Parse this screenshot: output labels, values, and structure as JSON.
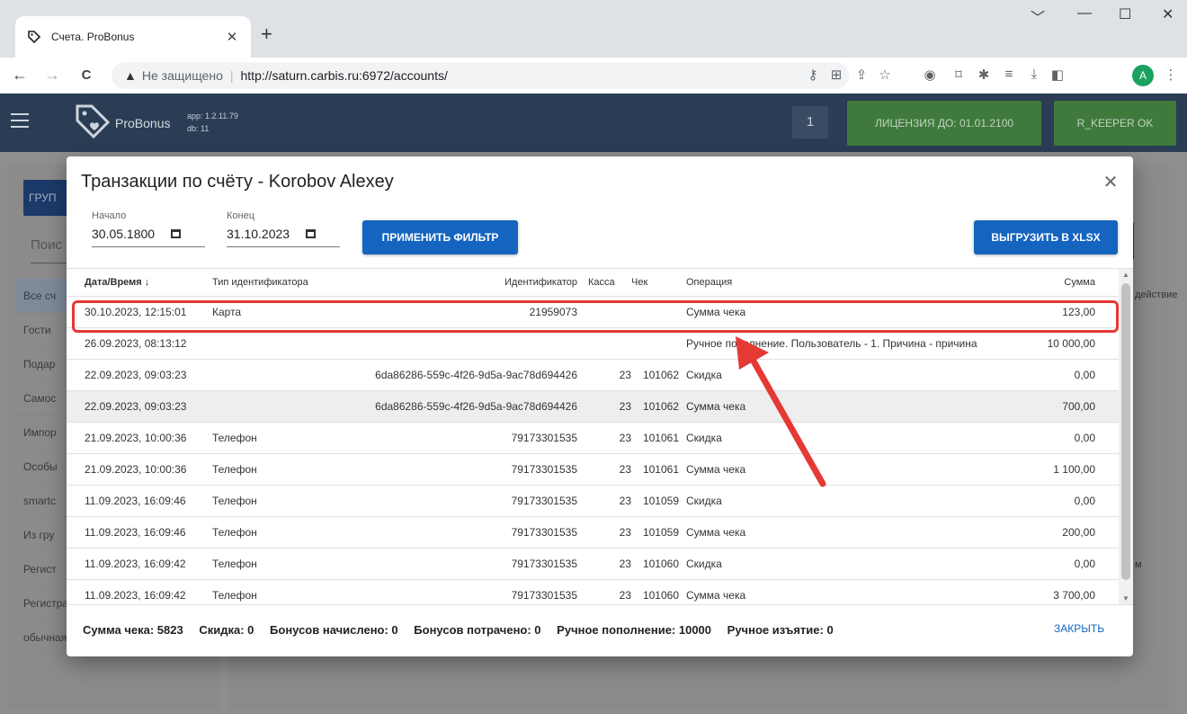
{
  "browser": {
    "tab_title": "Счета. ProBonus",
    "tab_close": "✕",
    "new_tab": "+",
    "window_controls": [
      "﹀",
      "—",
      "☐",
      "✕"
    ],
    "nav": [
      "←",
      "→",
      "C"
    ],
    "security_label": "Не защищено",
    "url": "http://saturn.carbis.ru:6972/accounts/",
    "profile_letter": "A",
    "menu_dots": "⋮"
  },
  "appbar": {
    "brand": "ProBonus",
    "app_version": "app: 1.2.11.79",
    "db_version": "db: 11",
    "counter": "1",
    "license": "ЛИЦЕНЗИЯ ДО: 01.01.2100",
    "rkeeper": "R_KEEPER OK"
  },
  "background": {
    "group_button": "ГРУП",
    "search_label": "Поис",
    "menu_items": [
      "Все сч",
      "Гости",
      "Подар",
      "Самос",
      "Импор",
      "Особы",
      "smartc",
      "Из гру",
      "Регист",
      "Регистрация по ссылке ...",
      "обычная группа счетов"
    ],
    "right_col_label": "действие",
    "right_col_m": "м"
  },
  "dialog": {
    "title": "Транзакции по счёту - Korobov Alexey",
    "close": "✕",
    "start_label": "Начало",
    "start_value": "30.05.1800",
    "end_label": "Конец",
    "end_value": "31.10.2023",
    "apply_button": "ПРИМЕНИТЬ ФИЛЬТР",
    "export_button": "ВЫГРУЗИТЬ В XLSX",
    "columns": [
      "Дата/Время ↓",
      "Тип идентификатора",
      "Идентификатор",
      "Касса",
      "Чек",
      "Операция",
      "Сумма"
    ],
    "rows": [
      [
        "30.10.2023, 12:15:01",
        "Карта",
        "21959073",
        "",
        "",
        "Сумма чека",
        "123,00"
      ],
      [
        "26.09.2023, 08:13:12",
        "",
        "",
        "",
        "",
        "Ручное пополнение. Пользователь - 1. Причина - причина",
        "10 000,00"
      ],
      [
        "22.09.2023, 09:03:23",
        "",
        "6da86286-559c-4f26-9d5a-9ac78d694426",
        "23",
        "101062",
        "Скидка",
        "0,00"
      ],
      [
        "22.09.2023, 09:03:23",
        "",
        "6da86286-559c-4f26-9d5a-9ac78d694426",
        "23",
        "101062",
        "Сумма чека",
        "700,00"
      ],
      [
        "21.09.2023, 10:00:36",
        "Телефон",
        "79173301535",
        "23",
        "101061",
        "Скидка",
        "0,00"
      ],
      [
        "21.09.2023, 10:00:36",
        "Телефон",
        "79173301535",
        "23",
        "101061",
        "Сумма чека",
        "1 100,00"
      ],
      [
        "11.09.2023, 16:09:46",
        "Телефон",
        "79173301535",
        "23",
        "101059",
        "Скидка",
        "0,00"
      ],
      [
        "11.09.2023, 16:09:46",
        "Телефон",
        "79173301535",
        "23",
        "101059",
        "Сумма чека",
        "200,00"
      ],
      [
        "11.09.2023, 16:09:42",
        "Телефон",
        "79173301535",
        "23",
        "101060",
        "Скидка",
        "0,00"
      ],
      [
        "11.09.2023, 16:09:42",
        "Телефон",
        "79173301535",
        "23",
        "101060",
        "Сумма чека",
        "3 700,00"
      ]
    ],
    "footer": {
      "check_sum": "Сумма чека: 5823",
      "discount": "Скидка: 0",
      "bonus_earned": "Бонусов начислено: 0",
      "bonus_spent": "Бонусов потрачено: 0",
      "manual_topup": "Ручное пополнение: 10000",
      "manual_withdraw": "Ручное изъятие: 0"
    },
    "close_button": "ЗАКРЫТЬ"
  },
  "colors": {
    "appbar": "#2a3d55",
    "accent": "#1565c0",
    "license_green": "#3f7a3c",
    "annotation": "#e53935"
  }
}
